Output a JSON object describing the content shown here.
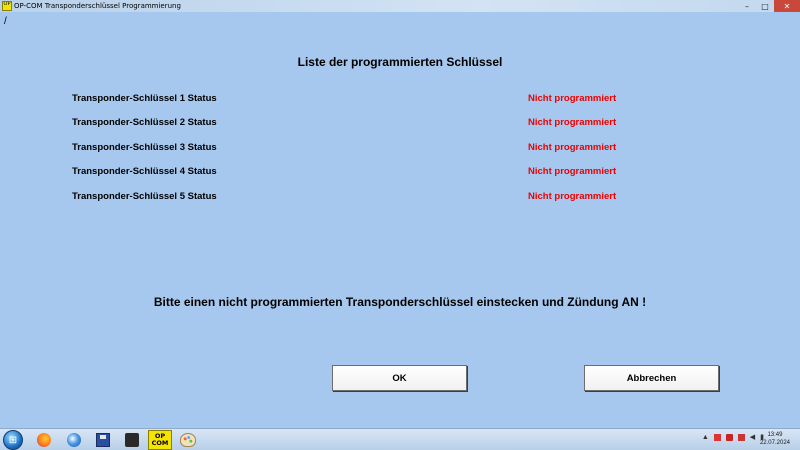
{
  "window": {
    "title": "OP-COM Transponderschlüssel Programmierung",
    "app_icon_text": "OP"
  },
  "path_mark": "/",
  "heading": "Liste der programmierten Schlüssel",
  "keys": [
    {
      "label": "Transponder-Schlüssel 1 Status",
      "status": "Nicht programmiert"
    },
    {
      "label": "Transponder-Schlüssel 2 Status",
      "status": "Nicht programmiert"
    },
    {
      "label": "Transponder-Schlüssel 3 Status",
      "status": "Nicht programmiert"
    },
    {
      "label": "Transponder-Schlüssel 4 Status",
      "status": "Nicht programmiert"
    },
    {
      "label": "Transponder-Schlüssel 5 Status",
      "status": "Nicht programmiert"
    }
  ],
  "instruction": "Bitte einen nicht programmierten Transponderschlüssel einstecken und Zündung AN !",
  "buttons": {
    "ok": "OK",
    "cancel": "Abbrechen"
  },
  "taskbar": {
    "opcom_line1": "OP",
    "opcom_line2": "COM",
    "apps": [
      "firefox-icon",
      "thunderbird-icon",
      "save-icon",
      "calculator-icon",
      "opcom-icon",
      "paint-icon"
    ]
  },
  "tray": {
    "time": "13:49",
    "date": "22.07.2024"
  },
  "colors": {
    "background": "#a6c8ee",
    "status_red": "#ee0000"
  }
}
